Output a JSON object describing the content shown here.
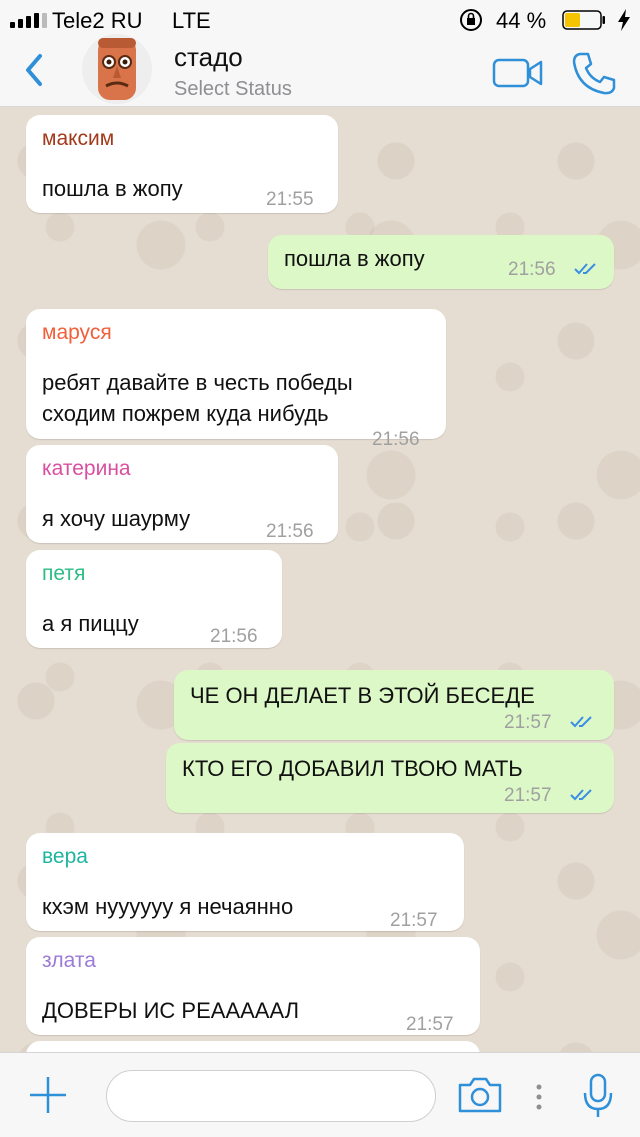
{
  "status_bar": {
    "carrier": "Tele2 RU",
    "network": "LTE",
    "battery_pct": "44 %",
    "battery_level": 0.44,
    "battery_color": "#f5c400"
  },
  "header": {
    "title": "стадо",
    "subtitle": "Select Status",
    "accent_color": "#2f8fd8"
  },
  "messages": [
    {
      "dir": "in",
      "sender": "максим",
      "sender_color": "#a2391a",
      "text": "пошла в жопу",
      "time": "21:55"
    },
    {
      "dir": "out",
      "text": "пошла в жопу",
      "time": "21:56",
      "read": true
    },
    {
      "dir": "in",
      "sender": "маруся",
      "sender_color": "#f0603a",
      "text1": "ребят давайте в честь победы",
      "text2": "сходим пожрем куда нибудь",
      "time": "21:56"
    },
    {
      "dir": "in",
      "sender": "катерина",
      "sender_color": "#d94fa0",
      "text": "я хочу шаурму",
      "time": "21:56"
    },
    {
      "dir": "in",
      "sender": "петя",
      "sender_color": "#2dbd85",
      "text": "а я пиццу",
      "time": "21:56"
    },
    {
      "dir": "out",
      "text": "ЧЕ ОН ДЕЛАЕТ В ЭТОЙ БЕСЕДЕ",
      "time": "21:57",
      "read": true
    },
    {
      "dir": "out",
      "text": "КТО ЕГО ДОБАВИЛ ТВОЮ МАТЬ",
      "time": "21:57",
      "read": true
    },
    {
      "dir": "in",
      "sender": "вера",
      "sender_color": "#1fb5a0",
      "text": "кхэм нуууууу я нечаянно",
      "time": "21:57"
    },
    {
      "dir": "in",
      "sender": "злата",
      "sender_color": "#9b7bd6",
      "text": "ДОВЕРЫ ИС РЕАААААЛ",
      "time": "21:57"
    }
  ],
  "input": {
    "placeholder": ""
  },
  "icons": {
    "back": "chevron-left-icon",
    "video": "video-camera-icon",
    "call": "phone-icon",
    "attach": "plus-icon",
    "camera": "camera-icon",
    "more": "vertical-dots-icon",
    "mic": "microphone-icon",
    "read_receipt": "double-check-icon"
  }
}
